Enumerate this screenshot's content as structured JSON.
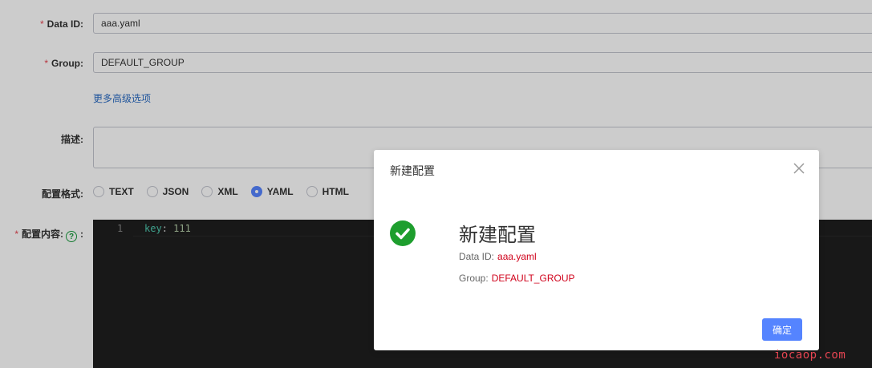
{
  "form": {
    "data_id": {
      "required_mark": "*",
      "label": "Data ID:",
      "value": "aaa.yaml"
    },
    "group": {
      "required_mark": "*",
      "label": "Group:",
      "value": "DEFAULT_GROUP"
    },
    "advanced_link": "更多高级选项",
    "description": {
      "label": "描述:",
      "value": ""
    },
    "format": {
      "label": "配置格式:",
      "options": [
        "TEXT",
        "JSON",
        "XML",
        "YAML",
        "HTML"
      ],
      "selected": "YAML"
    },
    "content": {
      "required_mark": "*",
      "label": "配置内容:",
      "help_glyph": "?",
      "label_suffix": ":",
      "line_number": "1",
      "code_key": "key",
      "code_colon": ":",
      "code_value": "111"
    }
  },
  "dialog": {
    "title": "新建配置",
    "close_glyph": "×",
    "result_title": "新建配置",
    "data_id_label": "Data ID:",
    "data_id_value": "aaa.yaml",
    "group_label": "Group:",
    "group_value": "DEFAULT_GROUP",
    "ok_label": "确定",
    "status_icon": "check-circle-icon",
    "accent_color": "#5584ff",
    "success_color": "#1e9e2e"
  },
  "watermark": "iocaop.com"
}
